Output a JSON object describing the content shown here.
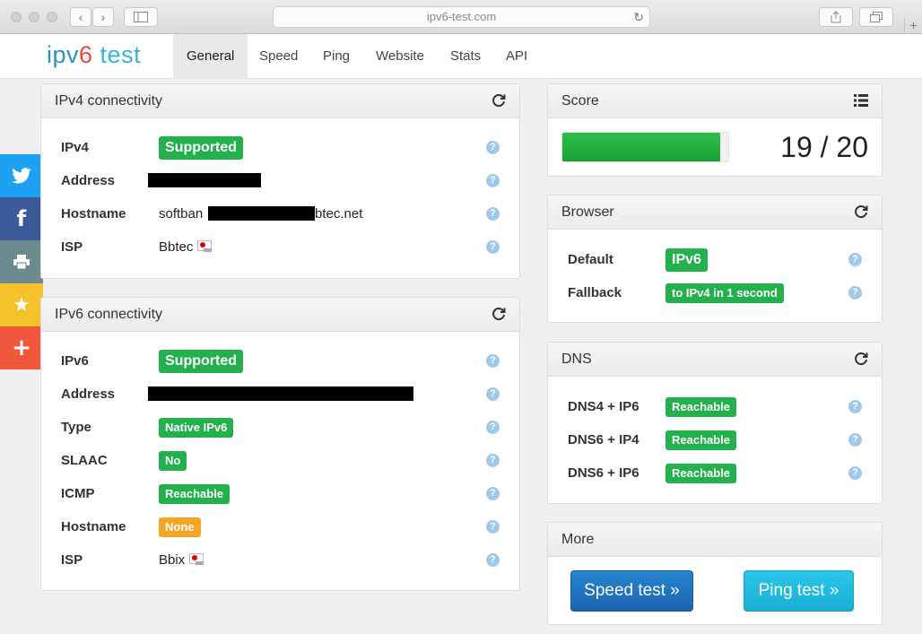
{
  "browser": {
    "url": "ipv6-test.com"
  },
  "site": {
    "logo": {
      "ipv": "ipv",
      "six": "6",
      "test": " test"
    },
    "nav": [
      "General",
      "Speed",
      "Ping",
      "Website",
      "Stats",
      "API"
    ],
    "active_nav": "General"
  },
  "social": [
    {
      "name": "twitter-button",
      "glyph": "🐦",
      "color": "#1da1f2"
    },
    {
      "name": "facebook-button",
      "glyph": "f",
      "color": "#3b5998"
    },
    {
      "name": "print-button",
      "glyph": "⎙",
      "color": "#6d8a8e"
    },
    {
      "name": "favorite-button",
      "glyph": "★",
      "color": "#f6c22c"
    },
    {
      "name": "share-more-button",
      "glyph": "+",
      "color": "#f2563b"
    }
  ],
  "ipv4": {
    "title": "IPv4 connectivity",
    "rows": {
      "ipv4": {
        "label": "IPv4",
        "badge": "Supported"
      },
      "address": {
        "label": "Address"
      },
      "hostname": {
        "label": "Hostname",
        "prefix": "softban",
        "suffix": "btec.net"
      },
      "isp": {
        "label": "ISP",
        "value": "Bbtec"
      }
    }
  },
  "ipv6": {
    "title": "IPv6 connectivity",
    "rows": {
      "ipv6": {
        "label": "IPv6",
        "badge": "Supported"
      },
      "address": {
        "label": "Address"
      },
      "type": {
        "label": "Type",
        "badge": "Native IPv6"
      },
      "slaac": {
        "label": "SLAAC",
        "badge": "No"
      },
      "icmp": {
        "label": "ICMP",
        "badge": "Reachable"
      },
      "hostname": {
        "label": "Hostname",
        "badge": "None"
      },
      "isp": {
        "label": "ISP",
        "value": "Bbix"
      }
    }
  },
  "score": {
    "title": "Score",
    "value": 19,
    "max": 20,
    "text": "19 / 20",
    "fill_fraction": 0.95
  },
  "browser_panel": {
    "title": "Browser",
    "rows": {
      "default": {
        "label": "Default",
        "badge": "IPv6"
      },
      "fallback": {
        "label": "Fallback",
        "badge": "to IPv4 in 1 second"
      }
    }
  },
  "dns": {
    "title": "DNS",
    "rows": {
      "dns4ip6": {
        "label": "DNS4 + IP6",
        "badge": "Reachable"
      },
      "dns6ip4": {
        "label": "DNS6 + IP4",
        "badge": "Reachable"
      },
      "dns6ip6": {
        "label": "DNS6 + IP6",
        "badge": "Reachable"
      }
    }
  },
  "more": {
    "title": "More",
    "speed_button": "Speed test »",
    "ping_button": "Ping test »"
  },
  "help_glyph": "?",
  "colors": {
    "success": "#23b14d",
    "warning": "#f5a623",
    "accent": "#2585d1"
  }
}
